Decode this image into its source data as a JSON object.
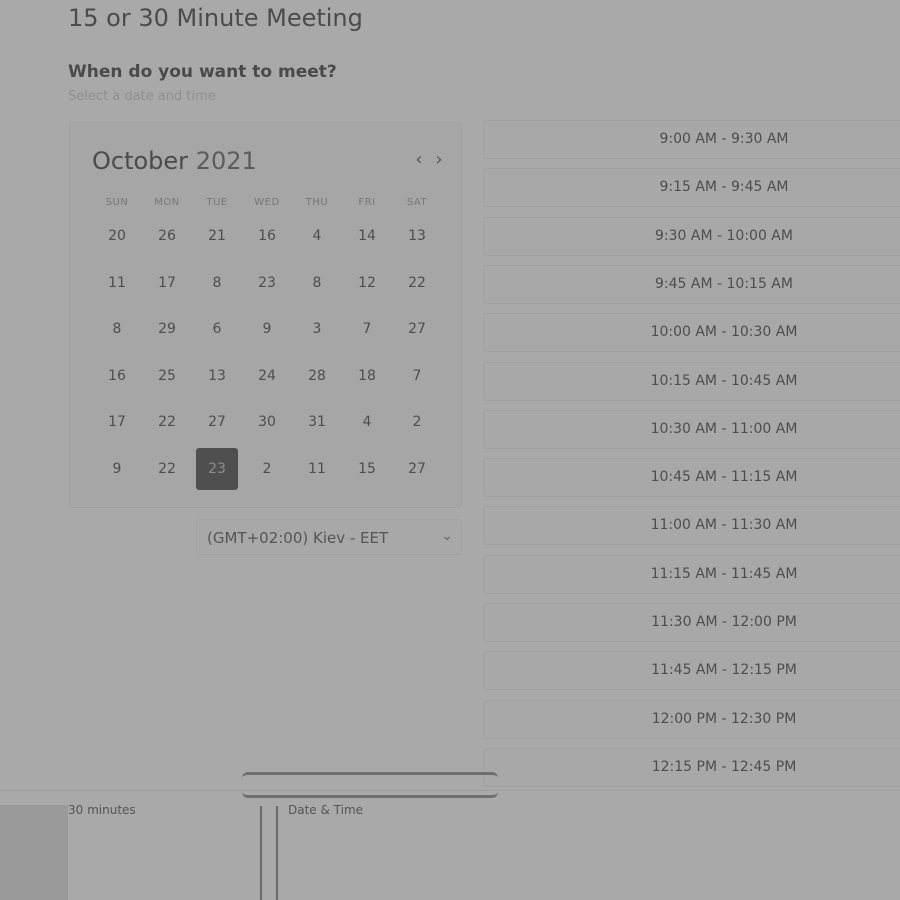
{
  "header": {
    "meeting_title": "15 or 30 Minute Meeting",
    "question": "When do you want to meet?",
    "subtitle": "Select a date and time"
  },
  "calendar": {
    "month": "October",
    "year": "2021",
    "prev_icon": "chevron-left-icon",
    "next_icon": "chevron-right-icon",
    "weekdays": [
      "SUN",
      "MON",
      "TUE",
      "WED",
      "THU",
      "FRI",
      "SAT"
    ],
    "days": [
      "20",
      "26",
      "21",
      "16",
      "4",
      "14",
      "13",
      "11",
      "17",
      "8",
      "23",
      "8",
      "12",
      "22",
      "8",
      "29",
      "6",
      "9",
      "3",
      "7",
      "27",
      "16",
      "25",
      "13",
      "24",
      "28",
      "18",
      "7",
      "17",
      "22",
      "27",
      "30",
      "31",
      "4",
      "2",
      "9",
      "22",
      "23",
      "2",
      "11",
      "15",
      "27"
    ],
    "selected_day": "23"
  },
  "timezone": {
    "label": "(GMT+02:00) Kiev - EET",
    "chevron_icon": "chevron-down-icon"
  },
  "time_slots": [
    "9:00 AM - 9:30 AM",
    "9:15 AM - 9:45 AM",
    "9:30 AM - 10:00 AM",
    "9:45 AM - 10:15 AM",
    "10:00 AM - 10:30 AM",
    "10:15 AM - 10:45 AM",
    "10:30 AM - 11:00 AM",
    "10:45 AM - 11:15 AM",
    "11:00 AM - 11:30 AM",
    "11:15 AM - 11:45 AM",
    "11:30 AM - 12:00 PM",
    "11:45 AM - 12:15 PM",
    "12:00 PM - 12:30 PM",
    "12:15 PM - 12:45 PM"
  ],
  "footer": {
    "steps": [
      "30 minutes",
      "Date & Time",
      "",
      ""
    ]
  }
}
